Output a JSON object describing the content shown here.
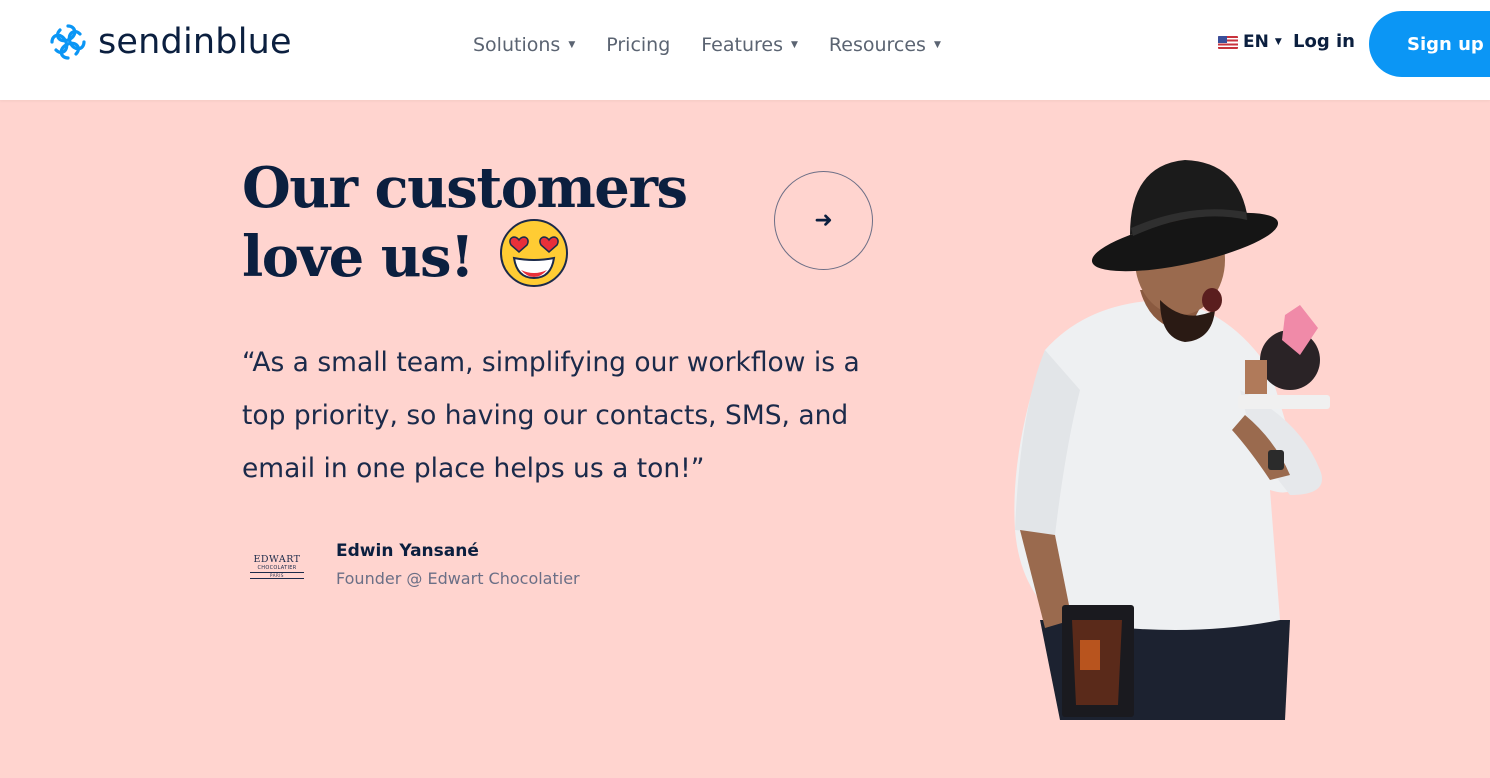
{
  "header": {
    "logo_text": "sendinblue",
    "nav": [
      {
        "label": "Solutions",
        "has_caret": true
      },
      {
        "label": "Pricing",
        "has_caret": false
      },
      {
        "label": "Features",
        "has_caret": true
      },
      {
        "label": "Resources",
        "has_caret": true
      }
    ],
    "language": {
      "label": "EN",
      "flag_icon": "us-flag-icon"
    },
    "login_label": "Log in",
    "signup_label": "Sign up free"
  },
  "hero": {
    "headline_line1": "Our customers",
    "headline_line2": "love us!",
    "emoji_icon": "heart-eyes-emoji-icon",
    "next_icon": "arrow-right-icon",
    "quote": "“As a small team, simplifying our workflow is a top priority, so having our contacts, SMS, and email in one place helps us a ton!”",
    "author": {
      "name": "Edwin Yansané",
      "role": "Founder @ Edwart Chocolatier",
      "logo_lines": [
        "EDWART",
        "CHOCOLATIER",
        "PARIS"
      ]
    }
  },
  "colors": {
    "background": "#ffd4cf",
    "primary_text": "#0b1f3f",
    "accent": "#0b96f5"
  }
}
